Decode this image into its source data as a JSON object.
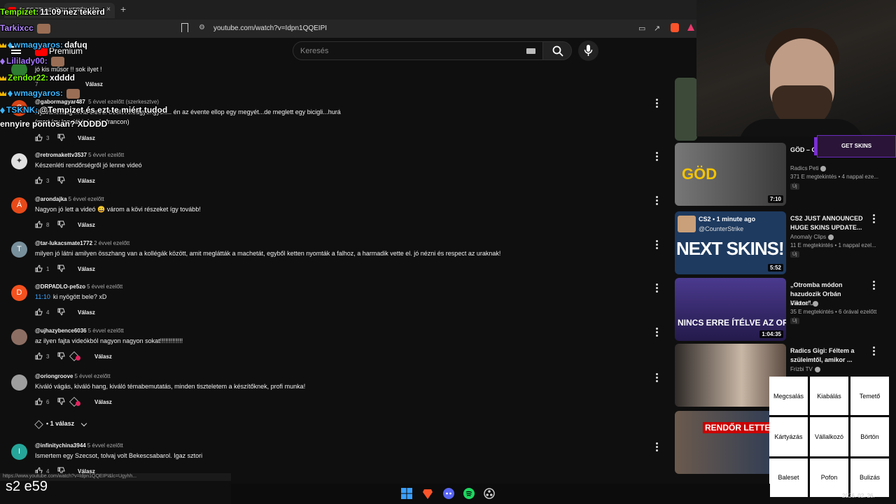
{
  "browser": {
    "tab_title": "ELFOGTUNK EGY KERÉKPÁR...",
    "tab_close": "×",
    "new_tab": "+",
    "url": "youtube.com/watch?v=Idpn1QQEIPI",
    "status_url": "https://www.youtube.com/watch?v=Idpn1QQEIPI&lc=Ugyhh..."
  },
  "youtube": {
    "premium_label": "Premium",
    "search_placeholder": "Keresés"
  },
  "comments": [
    {
      "user": "",
      "time": "",
      "text": "jó kis műsor !! sok ilyet !",
      "likes": "7",
      "reply": "Válasz",
      "avatar_letter": "",
      "avatar_color": "#2e7d32",
      "has_heart": false,
      "timestamp": ""
    },
    {
      "user": "@gabormagyar487",
      "time": "5 évvel ezelőtt (szerkesztve)",
      "text": "Nyilvánosság hívta életre: beeleveledgyöngyök... én az évente ellop egy megyét...de meglett egy bicigli...hurá",
      "text2": "(mert így legalább így de francon)",
      "likes": "3",
      "reply": "Válasz",
      "avatar_letter": "G",
      "avatar_color": "#d84315",
      "has_heart": false,
      "timestamp": ""
    },
    {
      "user": "@retromakettv3537",
      "time": "5 évvel ezelőtt",
      "text": "Készenléti rendőrségről jó lenne videó",
      "likes": "3",
      "reply": "Válasz",
      "avatar_letter": "",
      "avatar_color": "#e0e0e0",
      "has_heart": false,
      "timestamp": ""
    },
    {
      "user": "@arondajka",
      "time": "5 évvel ezelőtt",
      "text": "Nagyon jó lett a videó 😀 várom a kövi részeket így tovább!",
      "likes": "8",
      "reply": "Válasz",
      "avatar_letter": "Á",
      "avatar_color": "#e64a19",
      "has_heart": false,
      "timestamp": ""
    },
    {
      "user": "@tar-lukacsmate1772",
      "time": "2 évvel ezelőtt",
      "text": "milyen jó látni amilyen összhang van a kollégák között, amit meglátták a machetát, egyből ketten nyomták a falhoz, a harmadik vette el. jó nézni és respect az uraknak!",
      "likes": "1",
      "reply": "Válasz",
      "avatar_letter": "T",
      "avatar_color": "#78909c",
      "has_heart": false,
      "timestamp": ""
    },
    {
      "user": "@DRPADLO-pe5zo",
      "time": "5 évvel ezelőtt",
      "text": "ki nyögött bele? xD",
      "likes": "4",
      "reply": "Válasz",
      "avatar_letter": "D",
      "avatar_color": "#f4511e",
      "has_heart": false,
      "timestamp": "11:10"
    },
    {
      "user": "@ujhazybence6036",
      "time": "5 évvel ezelőtt",
      "text": "az ilyen fajta videókból nagyon nagyon sokat!!!!!!!!!!!!!",
      "likes": "3",
      "reply": "Válasz",
      "avatar_letter": "",
      "avatar_color": "#8d6e63",
      "has_heart": true,
      "timestamp": ""
    },
    {
      "user": "@oriongroove",
      "time": "5 évvel ezelőtt",
      "text": "Kiváló vágás, kiváló hang, kiváló témabemutatás, minden tiszteletem a készítőknek, profi munka!",
      "likes": "6",
      "reply": "Válasz",
      "avatar_letter": "",
      "avatar_color": "#9e9e9e",
      "has_heart": true,
      "timestamp": ""
    },
    {
      "user": "@infinitychina3944",
      "time": "5 évvel ezelőtt",
      "text": "Ismertem egy Szecsot, tolvaj volt Bekescsabarol. Igaz sztori",
      "likes": "4",
      "reply": "Válasz",
      "avatar_letter": "I",
      "avatar_color": "#26a69a",
      "has_heart": false,
      "timestamp": ""
    }
  ],
  "replies_toggle": "• 1 válasz",
  "sidebar": [
    {
      "title": "GÖD – C... (By:. Peti)",
      "channel": "Radics Peti",
      "stats": "371 E megtekintés • 4 nappal eze...",
      "badge": "Új",
      "duration": "7:10",
      "thumb_text": "GÖD",
      "thumb_color": "#555"
    },
    {
      "title": "CS2 JUST ANNOUNCED HUGE SKINS UPDATE...",
      "channel": "Anomaly Clips",
      "stats": "11 E megtekintés • 1 nappal ezel...",
      "badge": "Új",
      "duration": "5:52",
      "thumb_text": "NEXT SKINS!",
      "thumb_sub": "CS2 • 1 minute ago",
      "thumb_handle": "@CounterStrike",
      "thumb_color": "#1e3a5f"
    },
    {
      "title": "„Otromba módon hazudozik Orbán Viktor\"...",
      "channel": "Partizán",
      "stats": "35 E megtekintés • 6 órával ezelőtt",
      "badge": "Új",
      "duration": "1:04:35",
      "thumb_text": "NINCS ERRE ÍTÉLVE AZ ORSZÁG",
      "thumb_color": "#3b2a6e"
    },
    {
      "title": "Radics Gigi: Féltem a szüleimtől, amikor ...",
      "channel": "Frizbi TV",
      "stats": "",
      "badge": "",
      "duration": "",
      "thumb_text": "",
      "thumb_color": "#2f2a28"
    },
    {
      "title": "",
      "channel": "",
      "stats": "",
      "badge": "",
      "duration": "",
      "thumb_text": "RENDŐR LETTEM",
      "thumb_color": "#2a3a55"
    }
  ],
  "overlay": {
    "chat": [
      {
        "user": "Tempizet:",
        "msg": "11:09 nez tekerd",
        "color": "#7fff00",
        "badge": "",
        "emote": false
      },
      {
        "user": "Tarkixcc",
        "msg": "",
        "color": "#b388ff",
        "badge": "",
        "emote": true
      },
      {
        "user": "wmagyaros:",
        "msg": "dafuq",
        "color": "#3cb6ff",
        "badge": "crown",
        "emote": false
      },
      {
        "user": "Lililady00:",
        "msg": "",
        "color": "#a678ff",
        "badge": "sword",
        "emote": true
      },
      {
        "user": "Zendor22:",
        "msg": "xdddd",
        "color": "#7fff00",
        "badge": "crown",
        "emote": false
      },
      {
        "user": "wmagyaros:",
        "msg": "",
        "color": "#3cb6ff",
        "badge": "crown",
        "emote": true
      },
      {
        "user": "TSKNK:",
        "msg": "@Tempizet és ezt te miért tudod",
        "color": "#3cb6ff",
        "badge": "diamond",
        "emote": false
      },
      {
        "user": "",
        "msg": "ennyire pontosan? XDDDD",
        "color": "#fff",
        "badge": "",
        "emote": false
      }
    ],
    "get_skins": "GET SKINS",
    "episode": "s2 e59",
    "bingo": [
      "Megcsalás",
      "Kiabálás",
      "Temető",
      "Kártyázás",
      "Vállalkozó",
      "Börtön",
      "Baleset",
      "Pofon",
      "Bulizás"
    ],
    "date": "2026. 02. 26."
  }
}
